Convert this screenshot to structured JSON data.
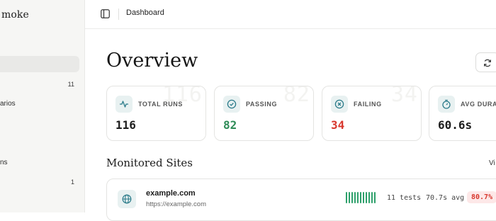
{
  "sidebar": {
    "brand": "moke",
    "items": [
      {
        "label": "",
        "count": "11"
      },
      {
        "label": "arios",
        "count": ""
      },
      {
        "label": "ns",
        "count": "1"
      }
    ]
  },
  "topbar": {
    "breadcrumb": "Dashboard"
  },
  "main": {
    "title": "Overview",
    "stats": [
      {
        "label": "TOTAL RUNS",
        "value": "116",
        "ghost": "116",
        "icon": "activity-icon"
      },
      {
        "label": "PASSING",
        "value": "82",
        "ghost": "82",
        "icon": "check-circle-icon"
      },
      {
        "label": "FAILING",
        "value": "34",
        "ghost": "34",
        "icon": "x-circle-icon"
      },
      {
        "label": "AVG DURATI",
        "value": "60.6s",
        "ghost": "",
        "icon": "timer-icon"
      }
    ],
    "section_title": "Monitored Sites",
    "view_link": "Vi",
    "sites": [
      {
        "name": "example.com",
        "url": "https://example.com",
        "tests": "11 tests",
        "avg": "70.7s avg",
        "rate": "80.7%"
      }
    ]
  },
  "colors": {
    "passing": "#2e8b57",
    "failing": "#d8382e",
    "icon_accent": "#2b7b8a",
    "icon_bg": "#e8f1f1"
  }
}
